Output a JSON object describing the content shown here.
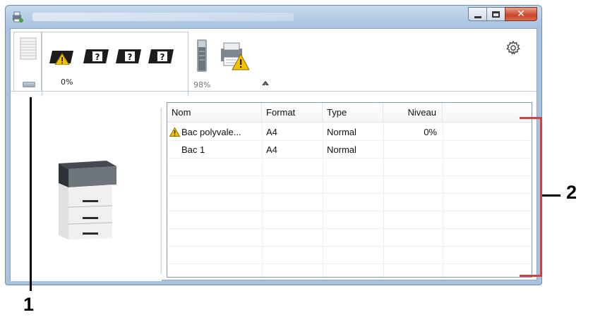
{
  "window": {
    "title": "",
    "controls": {
      "minimize_icon": "minimize-icon",
      "maximize_icon": "maximize-icon",
      "close_label": "✕"
    }
  },
  "toolbar": {
    "toner_level": "0%",
    "waste_toner_level": "98%",
    "unknown_toner_glyph": "?",
    "collapse_glyph": "^"
  },
  "table": {
    "columns": [
      "Nom",
      "Format",
      "Type",
      "Niveau"
    ],
    "rows": [
      {
        "name": "Bac polyvale...",
        "format": "A4",
        "type": "Normal",
        "level": "0%",
        "warning": true
      },
      {
        "name": "Bac 1",
        "format": "A4",
        "type": "Normal",
        "level": "",
        "warning": false
      }
    ]
  },
  "callouts": {
    "one": "1",
    "two": "2"
  },
  "colors": {
    "warning": "#f2c200",
    "bracket": "#d6413f",
    "titlebar": "#a9c3df",
    "close": "#c8452a"
  }
}
